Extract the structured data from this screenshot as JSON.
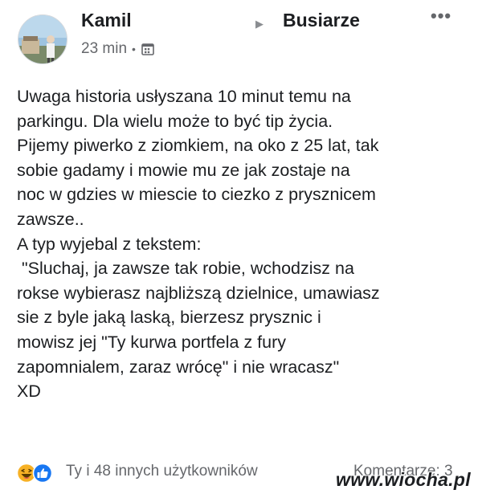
{
  "post": {
    "author": "Kamil",
    "group_arrow": "▶",
    "group": "Busiarze",
    "more_icon": "•••",
    "time": "23 min",
    "separator": "•",
    "body_lines": [
      "Uwaga historia usłyszana 10 minut temu na",
      "parkingu. Dla wielu może to być tip życia.",
      "Pijemy piwerko z ziomkiem, na oko z 25 lat, tak",
      "sobie gadamy i mowie mu ze jak zostaje na",
      "noc w gdzies w miescie to ciezko z prysznicem",
      "zawsze..",
      "A typ wyjebal z tekstem:",
      " \"Sluchaj, ja zawsze tak robie, wchodzisz na",
      "rokse wybierasz najbliższą dzielnice, umawiasz",
      "sie z byle jaką laską, bierzesz prysznic i",
      "mowisz jej \"Ty kurwa portfela z fury",
      "zapomnialem, zaraz wrócę\" i nie wracasz\"",
      "XD"
    ],
    "reactions": {
      "icons": [
        "laughing-emoji-icon",
        "like-thumb-icon"
      ],
      "text": "Ty i 48 innych użytkowników"
    },
    "comments": "Komentarze: 3"
  },
  "watermark": "www.wiocha.pl",
  "colors": {
    "text": "#1c1e21",
    "secondary": "#65676b",
    "like_blue": "#1877f2",
    "haha_yellow": "#f7b125"
  }
}
